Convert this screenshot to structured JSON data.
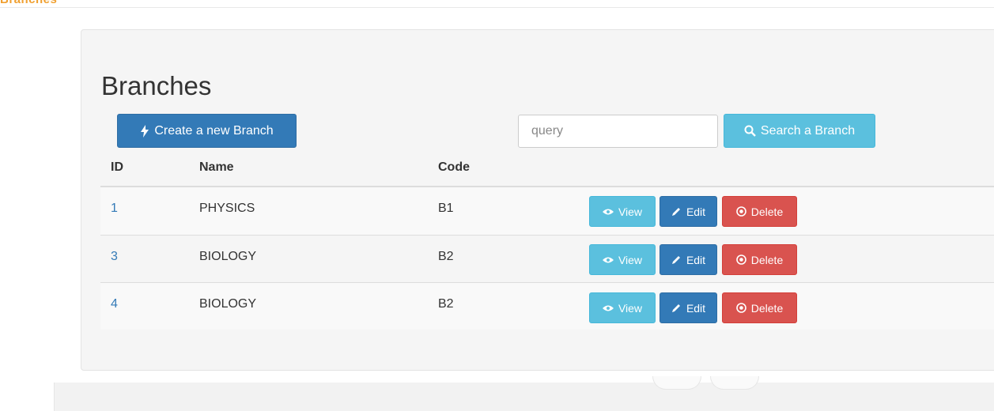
{
  "brand": {
    "text": "Branches",
    "color": "#f0a030"
  },
  "page": {
    "title": "Branches"
  },
  "toolbar": {
    "create_label": "Create a new Branch",
    "search_placeholder": "query",
    "search_value": "",
    "search_label": "Search a Branch"
  },
  "table": {
    "headers": {
      "id": "ID",
      "name": "Name",
      "code": "Code"
    },
    "rows": [
      {
        "id": "1",
        "name": "PHYSICS",
        "code": "B1"
      },
      {
        "id": "3",
        "name": "BIOLOGY",
        "code": "B2"
      },
      {
        "id": "4",
        "name": "BIOLOGY",
        "code": "B2"
      }
    ],
    "actions": {
      "view": "View",
      "edit": "Edit",
      "delete": "Delete"
    }
  },
  "icons": {
    "create": "bolt-icon",
    "search": "search-icon",
    "view": "eye-icon",
    "edit": "pencil-icon",
    "delete": "remove-circle-icon"
  },
  "colors": {
    "primary": "#337ab7",
    "info": "#5bc0de",
    "danger": "#d9534f",
    "link": "#337ab7"
  }
}
